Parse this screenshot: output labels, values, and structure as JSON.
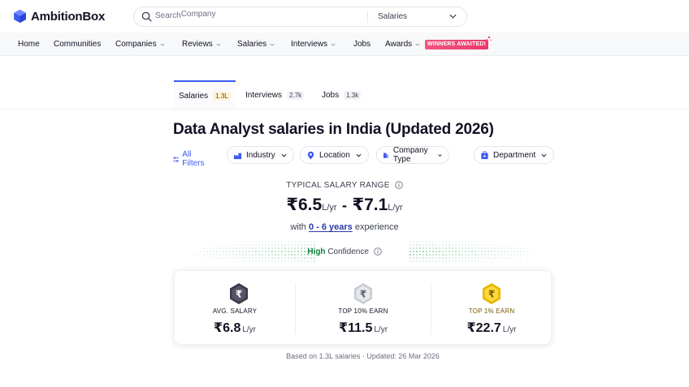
{
  "brand": {
    "name": "AmbitionBox",
    "accent": "#3d5af1"
  },
  "search": {
    "placeholder_prefix": "Search",
    "placeholder_company": "Company",
    "category": "Salaries"
  },
  "nav": {
    "items": [
      {
        "label": "Home"
      },
      {
        "label": "Communities"
      },
      {
        "label": "Companies"
      },
      {
        "label": "Reviews"
      },
      {
        "label": "Salaries"
      },
      {
        "label": "Interviews"
      },
      {
        "label": "Jobs"
      },
      {
        "label": "Awards"
      }
    ],
    "awards_badge": "WINNERS AWAITED!"
  },
  "tabs": [
    {
      "label": "Salaries",
      "count": "1.3L",
      "active": true
    },
    {
      "label": "Interviews",
      "count": "2.7k"
    },
    {
      "label": "Jobs",
      "count": "1.3k"
    }
  ],
  "page_title": "Data Analyst salaries in India (Updated 2026)",
  "filters": {
    "all": "All Filters",
    "items": [
      {
        "label": "Industry",
        "icon": "industry-icon"
      },
      {
        "label": "Location",
        "icon": "location-pin-icon"
      },
      {
        "label": "Company Type",
        "icon": "building-icon"
      },
      {
        "label": "Department",
        "icon": "department-icon"
      }
    ]
  },
  "salary_range": {
    "label": "TYPICAL SALARY RANGE",
    "min": "₹6.5",
    "max": "₹7.1",
    "unit": "L/yr",
    "separator": "-",
    "exp_prefix": "with",
    "exp_years": "0 - 6 years",
    "exp_suffix": "experience"
  },
  "confidence": {
    "level": "High",
    "label": "Confidence"
  },
  "stats": [
    {
      "label": "AVG. SALARY",
      "value": "₹6.8",
      "unit": "L/yr",
      "coin": "dark"
    },
    {
      "label": "TOP 10% EARN",
      "value": "₹11.5",
      "unit": "L/yr",
      "coin": "silver"
    },
    {
      "label": "TOP 1% EARN",
      "value": "₹22.7",
      "unit": "L/yr",
      "coin": "gold"
    }
  ],
  "footnote": "Based on 1.3L salaries · Updated: 26 Mar 2026"
}
